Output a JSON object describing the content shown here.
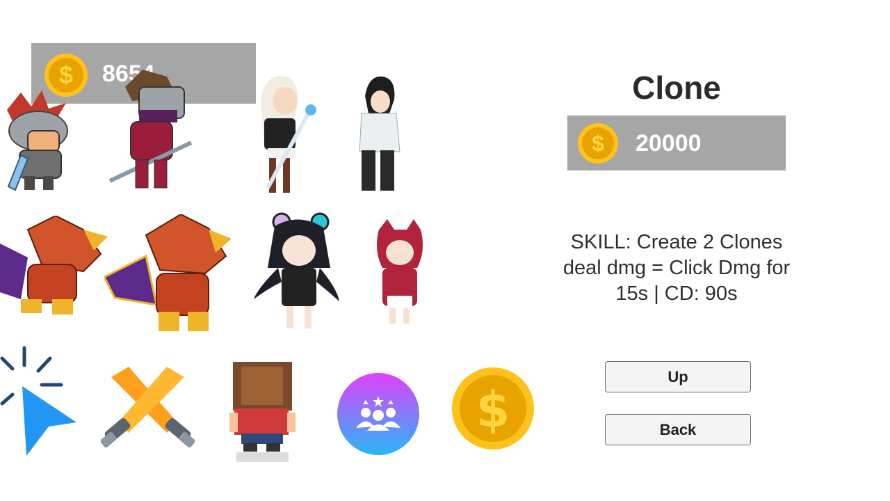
{
  "player_gold": {
    "value": "8654",
    "coin_icon": "dollar-coin-icon",
    "symbol": "$"
  },
  "item": {
    "title": "Clone",
    "price": "20000",
    "price_symbol": "$",
    "description": "SKILL: Create 2 Clones deal dmg = Click Dmg for 15s | CD: 90s"
  },
  "buttons": {
    "up_label": "Up",
    "back_label": "Back"
  },
  "sprites": [
    "red-knight-icon",
    "ninja-swordsman-icon",
    "staff-girl-icon",
    "black-hair-girl-icon",
    "orange-dragon-icon",
    "orange-dragon-2-icon",
    "bear-ear-girl-icon",
    "cat-hood-girl-icon",
    "click-cursor-icon",
    "crossed-swords-icon",
    "pixel-boy-icon",
    "team-upgrade-icon",
    "gold-coin-icon"
  ],
  "colors": {
    "panel_gray": "#a6a6a6",
    "coin_gold": "#ffc21a",
    "coin_dark": "#e8a300"
  }
}
